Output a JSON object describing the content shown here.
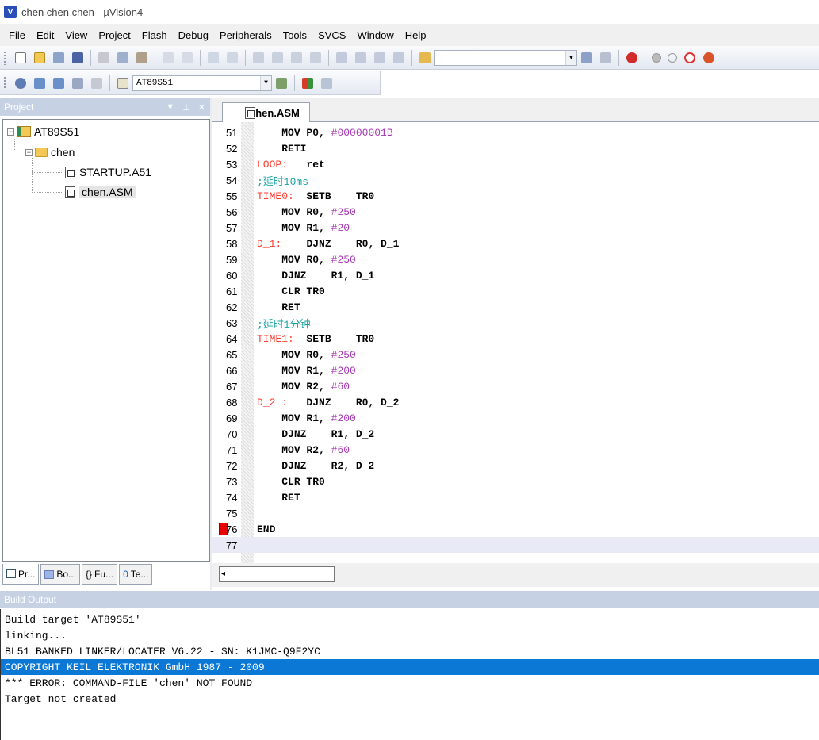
{
  "window": {
    "title": "chen chen chen  - µVision4"
  },
  "menu": [
    {
      "label": "File",
      "u": "F",
      "rest": "ile"
    },
    {
      "label": "Edit",
      "u": "E",
      "rest": "dit"
    },
    {
      "label": "View",
      "u": "V",
      "rest": "iew"
    },
    {
      "label": "Project",
      "u": "P",
      "rest": "roject"
    },
    {
      "label": "Flash",
      "pre": "Fl",
      "u": "a",
      "rest": "sh"
    },
    {
      "label": "Debug",
      "u": "D",
      "rest": "ebug"
    },
    {
      "label": "Peripherals",
      "pre": "Pe",
      "u": "r",
      "rest": "ipherals"
    },
    {
      "label": "Tools",
      "u": "T",
      "rest": "ools"
    },
    {
      "label": "SVCS",
      "u": "S",
      "rest": "VCS"
    },
    {
      "label": "Window",
      "u": "W",
      "rest": "indow"
    },
    {
      "label": "Help",
      "u": "H",
      "rest": "elp"
    }
  ],
  "toolbar2": {
    "target": "AT89S51"
  },
  "project": {
    "header": "Project",
    "tree": {
      "target": "AT89S51",
      "group": "chen",
      "files": [
        "STARTUP.A51",
        "chen.ASM"
      ]
    },
    "tabs": [
      "Pr...",
      "Bo...",
      "Fu...",
      "Te..."
    ]
  },
  "editor": {
    "tab": "chen.ASM",
    "lines": [
      {
        "n": "51",
        "parts": [
          [
            "",
            "    "
          ],
          [
            "kw",
            "MOV P0, "
          ],
          [
            "num",
            "#00000001B"
          ]
        ]
      },
      {
        "n": "52",
        "parts": [
          [
            "",
            "    "
          ],
          [
            "kw",
            "RETI"
          ]
        ]
      },
      {
        "n": "53",
        "parts": [
          [
            "label",
            "LOOP:"
          ],
          [
            "",
            "   "
          ],
          [
            "kw",
            "ret"
          ]
        ]
      },
      {
        "n": "54",
        "parts": [
          [
            "cmt",
            ";延时10ms"
          ]
        ]
      },
      {
        "n": "55",
        "parts": [
          [
            "label",
            "TIME0:"
          ],
          [
            "",
            "  "
          ],
          [
            "kw",
            "SETB    TR0"
          ]
        ]
      },
      {
        "n": "56",
        "parts": [
          [
            "",
            "    "
          ],
          [
            "kw",
            "MOV R0, "
          ],
          [
            "num",
            "#250"
          ]
        ]
      },
      {
        "n": "57",
        "parts": [
          [
            "",
            "    "
          ],
          [
            "kw",
            "MOV R1, "
          ],
          [
            "num",
            "#20"
          ]
        ]
      },
      {
        "n": "58",
        "parts": [
          [
            "label",
            "D_1:"
          ],
          [
            "",
            "    "
          ],
          [
            "kw",
            "DJNZ    R0, D_1"
          ]
        ]
      },
      {
        "n": "59",
        "parts": [
          [
            "",
            "    "
          ],
          [
            "kw",
            "MOV R0, "
          ],
          [
            "num",
            "#250"
          ]
        ]
      },
      {
        "n": "60",
        "parts": [
          [
            "",
            "    "
          ],
          [
            "kw",
            "DJNZ    R1, D_1"
          ]
        ]
      },
      {
        "n": "61",
        "parts": [
          [
            "",
            "    "
          ],
          [
            "kw",
            "CLR TR0"
          ]
        ]
      },
      {
        "n": "62",
        "parts": [
          [
            "",
            "    "
          ],
          [
            "kw",
            "RET"
          ]
        ]
      },
      {
        "n": "63",
        "parts": [
          [
            "cmt",
            ";延时1分钟"
          ]
        ]
      },
      {
        "n": "64",
        "parts": [
          [
            "label",
            "TIME1:"
          ],
          [
            "",
            "  "
          ],
          [
            "kw",
            "SETB    TR0"
          ]
        ]
      },
      {
        "n": "65",
        "parts": [
          [
            "",
            "    "
          ],
          [
            "kw",
            "MOV R0, "
          ],
          [
            "num",
            "#250"
          ]
        ]
      },
      {
        "n": "66",
        "parts": [
          [
            "",
            "    "
          ],
          [
            "kw",
            "MOV R1, "
          ],
          [
            "num",
            "#200"
          ]
        ]
      },
      {
        "n": "67",
        "parts": [
          [
            "",
            "    "
          ],
          [
            "kw",
            "MOV R2, "
          ],
          [
            "num",
            "#60"
          ]
        ]
      },
      {
        "n": "68",
        "parts": [
          [
            "label",
            "D_2 :"
          ],
          [
            "",
            "   "
          ],
          [
            "kw",
            "DJNZ    R0, D_2"
          ]
        ]
      },
      {
        "n": "69",
        "parts": [
          [
            "",
            "    "
          ],
          [
            "kw",
            "MOV R1, "
          ],
          [
            "num",
            "#200"
          ]
        ]
      },
      {
        "n": "70",
        "parts": [
          [
            "",
            "    "
          ],
          [
            "kw",
            "DJNZ    R1, D_2"
          ]
        ]
      },
      {
        "n": "71",
        "parts": [
          [
            "",
            "    "
          ],
          [
            "kw",
            "MOV R2, "
          ],
          [
            "num",
            "#60"
          ]
        ]
      },
      {
        "n": "72",
        "parts": [
          [
            "",
            "    "
          ],
          [
            "kw",
            "DJNZ    R2, D_2"
          ]
        ]
      },
      {
        "n": "73",
        "parts": [
          [
            "",
            "    "
          ],
          [
            "kw",
            "CLR TR0"
          ]
        ]
      },
      {
        "n": "74",
        "parts": [
          [
            "",
            "    "
          ],
          [
            "kw",
            "RET"
          ]
        ]
      },
      {
        "n": "75",
        "parts": []
      },
      {
        "n": "76",
        "parts": [
          [
            "kw",
            "END"
          ]
        ],
        "breakpoint": true
      },
      {
        "n": "77",
        "parts": [],
        "current": true
      }
    ]
  },
  "build": {
    "header": "Build Output",
    "lines": [
      "Build target 'AT89S51'",
      "linking...",
      "BL51 BANKED LINKER/LOCATER V6.22 - SN: K1JMC-Q9F2YC",
      "COPYRIGHT KEIL ELEKTRONIK GmbH 1987 - 2009",
      "*** ERROR: COMMAND-FILE 'chen' NOT FOUND",
      "Target not created"
    ],
    "highlighted_index": 3
  },
  "colors": {
    "label": "#ff3b30",
    "number": "#a637b3",
    "comment": "#19a3a3",
    "selection": "#0a78d4",
    "breakpoint": "#e60000"
  }
}
